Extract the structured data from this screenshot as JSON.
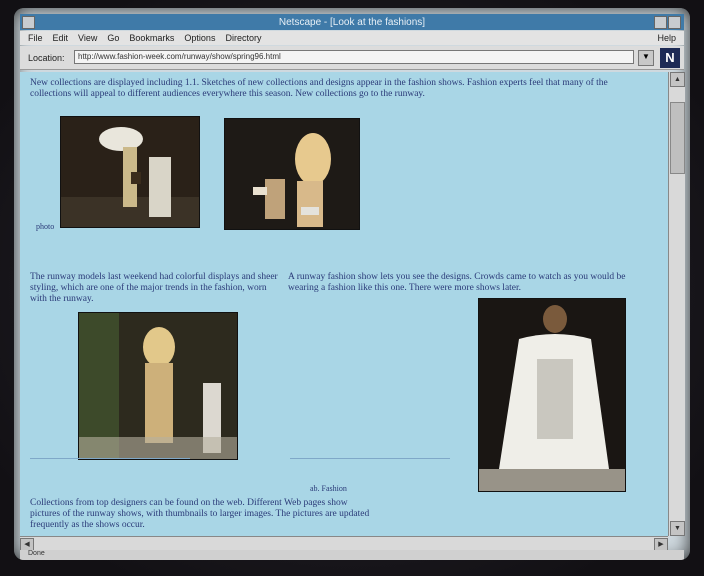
{
  "browser": {
    "title": "Netscape - [Look at the fashions]",
    "menu": [
      "File",
      "Edit",
      "View",
      "Go",
      "Bookmarks",
      "Options",
      "Directory",
      "Help"
    ],
    "location_label": "Location:",
    "url": "http://www.fashion-week.com/runway/show/spring96.html",
    "logo_letter": "N",
    "status": "Done"
  },
  "page": {
    "intro_text": "New collections are displayed including 1.1. Sketches of new collections and designs appear in the fashion shows. Fashion experts feel that many of the collections will appeal to different audiences everywhere this season. New collections go to the runway.",
    "photo1_caption": "photo",
    "left_text": "The runway models last weekend had colorful displays and sheer styling, which are one of the major trends in the fashion, worn with the runway.",
    "right_text": "A runway fashion show lets you see the designs. Crowds came to watch as you would be wearing a fashion like this one. There were more shows later.",
    "bottom_text": "Collections from top designers can be found on the web. Different Web pages show pictures of the runway shows, with thumbnails to larger images. The pictures are updated frequently as the shows occur.",
    "bottom_label": "ab. Fashion"
  },
  "colors": {
    "page_bg": "#a9d6e6",
    "text": "#2a3a78",
    "titlebar": "#3f7aa8"
  }
}
